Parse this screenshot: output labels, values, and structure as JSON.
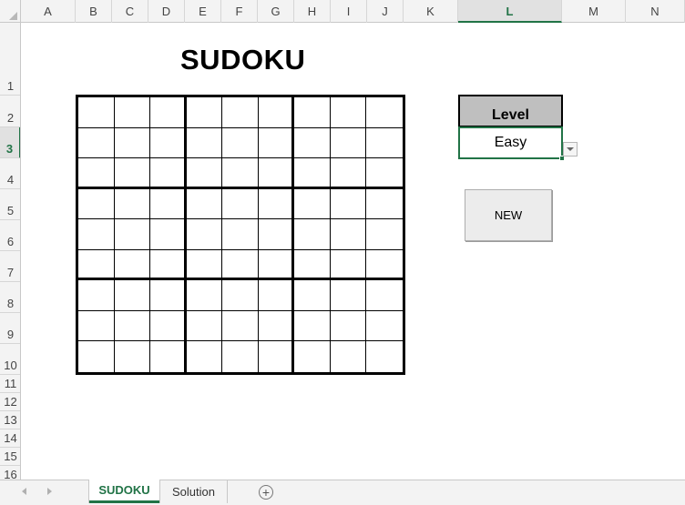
{
  "columns": [
    "A",
    "B",
    "C",
    "D",
    "E",
    "F",
    "G",
    "H",
    "I",
    "J",
    "K",
    "L",
    "M",
    "N"
  ],
  "rows": [
    "1",
    "2",
    "3",
    "4",
    "5",
    "6",
    "7",
    "8",
    "9",
    "10",
    "11",
    "12",
    "13",
    "14",
    "15",
    "16"
  ],
  "selected_column": "L",
  "selected_row": "3",
  "title": "SUDOKU",
  "grid": [
    [
      "",
      "",
      "",
      "",
      "",
      "",
      "",
      "",
      ""
    ],
    [
      "",
      "",
      "",
      "",
      "",
      "",
      "",
      "",
      ""
    ],
    [
      "",
      "",
      "",
      "",
      "",
      "",
      "",
      "",
      ""
    ],
    [
      "",
      "",
      "",
      "",
      "",
      "",
      "",
      "",
      ""
    ],
    [
      "",
      "",
      "",
      "",
      "",
      "",
      "",
      "",
      ""
    ],
    [
      "",
      "",
      "",
      "",
      "",
      "",
      "",
      "",
      ""
    ],
    [
      "",
      "",
      "",
      "",
      "",
      "",
      "",
      "",
      ""
    ],
    [
      "",
      "",
      "",
      "",
      "",
      "",
      "",
      "",
      ""
    ],
    [
      "",
      "",
      "",
      "",
      "",
      "",
      "",
      "",
      ""
    ]
  ],
  "level": {
    "label": "Level",
    "value": "Easy"
  },
  "new_button": "NEW",
  "sheet_tabs": [
    {
      "label": "SUDOKU",
      "active": true
    },
    {
      "label": "Solution",
      "active": false
    }
  ],
  "add_sheet_symbol": "+",
  "colors": {
    "accent": "#217346",
    "level_header_bg": "#bfbfbf"
  }
}
